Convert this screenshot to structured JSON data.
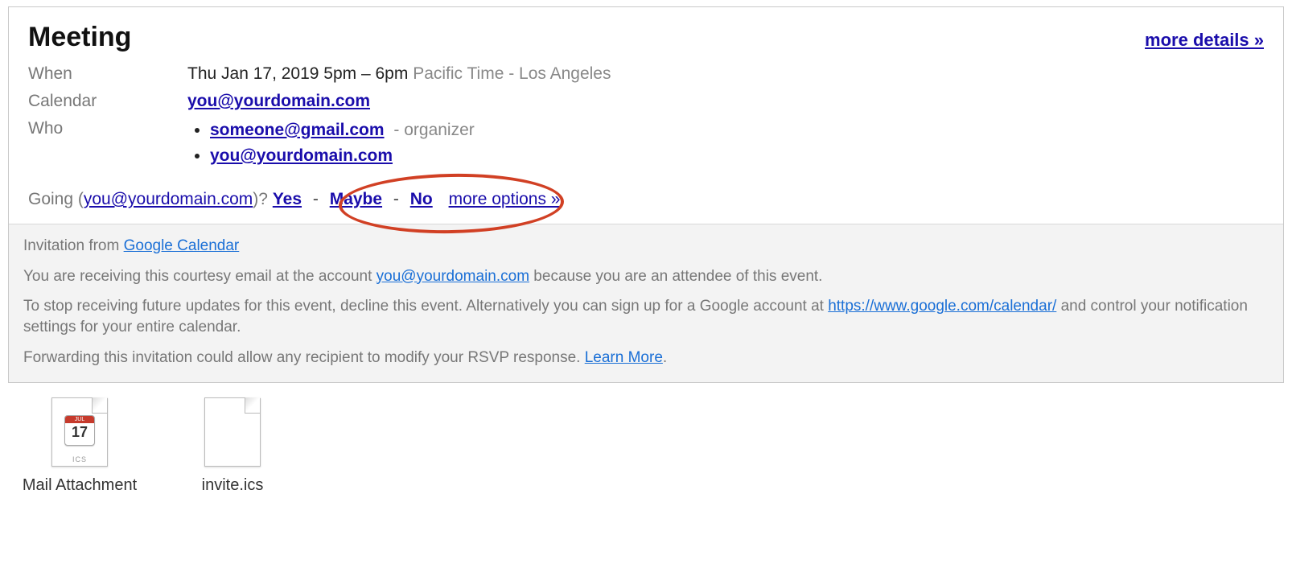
{
  "event": {
    "title": "Meeting",
    "more_details": "more details »",
    "labels": {
      "when": "When",
      "calendar": "Calendar",
      "who": "Who"
    },
    "when_main": "Thu Jan 17, 2019 5pm – 6pm ",
    "when_tz": "Pacific Time - Los Angeles",
    "calendar_email": "you@yourdomain.com",
    "who": [
      {
        "email": "someone@gmail.com",
        "suffix": "- organizer"
      },
      {
        "email": "you@yourdomain.com",
        "suffix": ""
      }
    ],
    "going": {
      "prefix": "Going (",
      "email": "you@yourdomain.com",
      "suffix": ")?  ",
      "yes": "Yes",
      "maybe": "Maybe",
      "no": "No",
      "sep": " - ",
      "more": "more options »"
    }
  },
  "footer": {
    "inv_pre": "Invitation from ",
    "inv_link": "Google Calendar",
    "l2a": "You are receiving this courtesy email at the account ",
    "l2link": "you@yourdomain.com",
    "l2b": " because you are an attendee of this event.",
    "l3a": "To stop receiving future updates for this event, decline this event. Alternatively you can sign up for a Google account at ",
    "l3link": "https://www.google.com/calendar/",
    "l3b": " and control your notification settings for your entire calendar.",
    "l4a": "Forwarding this invitation could allow any recipient to modify your RSVP response. ",
    "l4link": "Learn More",
    "l4b": "."
  },
  "attachments": {
    "a1": "Mail Attachment",
    "a2": "invite.ics",
    "cal_month": "JUL",
    "cal_day": "17",
    "ics": "ICS"
  }
}
